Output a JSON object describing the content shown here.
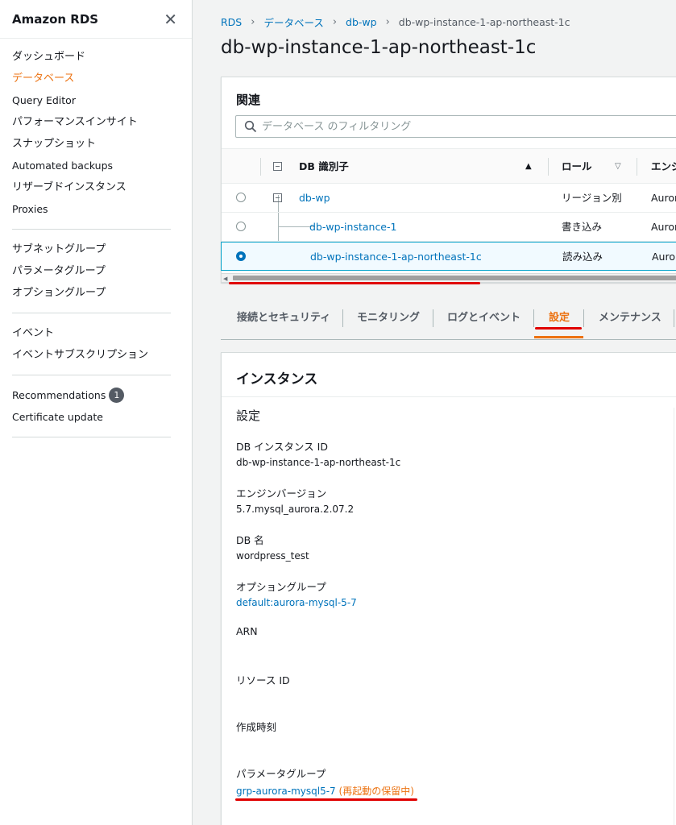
{
  "sidebar": {
    "title": "Amazon RDS",
    "groups": [
      [
        {
          "label": "ダッシュボード",
          "active": false
        },
        {
          "label": "データベース",
          "active": true
        },
        {
          "label": "Query Editor",
          "active": false
        },
        {
          "label": "パフォーマンスインサイト",
          "active": false
        },
        {
          "label": "スナップショット",
          "active": false
        },
        {
          "label": "Automated backups",
          "active": false
        },
        {
          "label": "リザーブドインスタンス",
          "active": false
        },
        {
          "label": "Proxies",
          "active": false
        }
      ],
      [
        {
          "label": "サブネットグループ",
          "active": false
        },
        {
          "label": "パラメータグループ",
          "active": false
        },
        {
          "label": "オプショングループ",
          "active": false
        }
      ],
      [
        {
          "label": "イベント",
          "active": false
        },
        {
          "label": "イベントサブスクリプション",
          "active": false
        }
      ],
      [
        {
          "label": "Recommendations",
          "active": false,
          "badge": "1"
        },
        {
          "label": "Certificate update",
          "active": false
        }
      ]
    ]
  },
  "breadcrumb": {
    "items": [
      "RDS",
      "データベース",
      "db-wp"
    ],
    "current": "db-wp-instance-1-ap-northeast-1c"
  },
  "page_title": "db-wp-instance-1-ap-northeast-1c",
  "related": {
    "title": "関連",
    "filter_placeholder": "データベース のフィルタリング",
    "columns": {
      "identifier": "DB 識別子",
      "role": "ロール",
      "engine": "エンジ"
    },
    "rows": [
      {
        "identifier": "db-wp",
        "role": "リージョン別",
        "engine": "Auror",
        "selected": false
      },
      {
        "identifier": "db-wp-instance-1",
        "role": "書き込み",
        "engine": "Auror",
        "selected": false
      },
      {
        "identifier": "db-wp-instance-1-ap-northeast-1c",
        "role": "読み込み",
        "engine": "Auror",
        "selected": true
      }
    ]
  },
  "tabs": [
    {
      "label": "接続とセキュリティ",
      "active": false
    },
    {
      "label": "モニタリング",
      "active": false
    },
    {
      "label": "ログとイベント",
      "active": false
    },
    {
      "label": "設定",
      "active": true
    },
    {
      "label": "メンテナンス",
      "active": false
    }
  ],
  "instance": {
    "title": "インスタンス",
    "section_title": "設定",
    "fields": {
      "db_instance_id": {
        "label": "DB インスタンス ID",
        "value": "db-wp-instance-1-ap-northeast-1c"
      },
      "engine_version": {
        "label": "エンジンバージョン",
        "value": "5.7.mysql_aurora.2.07.2"
      },
      "db_name": {
        "label": "DB 名",
        "value": "wordpress_test"
      },
      "option_group": {
        "label": "オプショングループ",
        "value": "default:aurora-mysql-5-7"
      },
      "arn": {
        "label": "ARN",
        "value": ""
      },
      "resource_id": {
        "label": "リソース ID",
        "value": ""
      },
      "created_time": {
        "label": "作成時刻",
        "value": ""
      },
      "parameter_group": {
        "label": "パラメータグループ",
        "value": "grp-aurora-mysql5-7",
        "status": "(再起動の保留中)"
      }
    }
  },
  "colors": {
    "accent": "#ec7211",
    "link": "#0073bb",
    "annotation": "#e00000"
  }
}
